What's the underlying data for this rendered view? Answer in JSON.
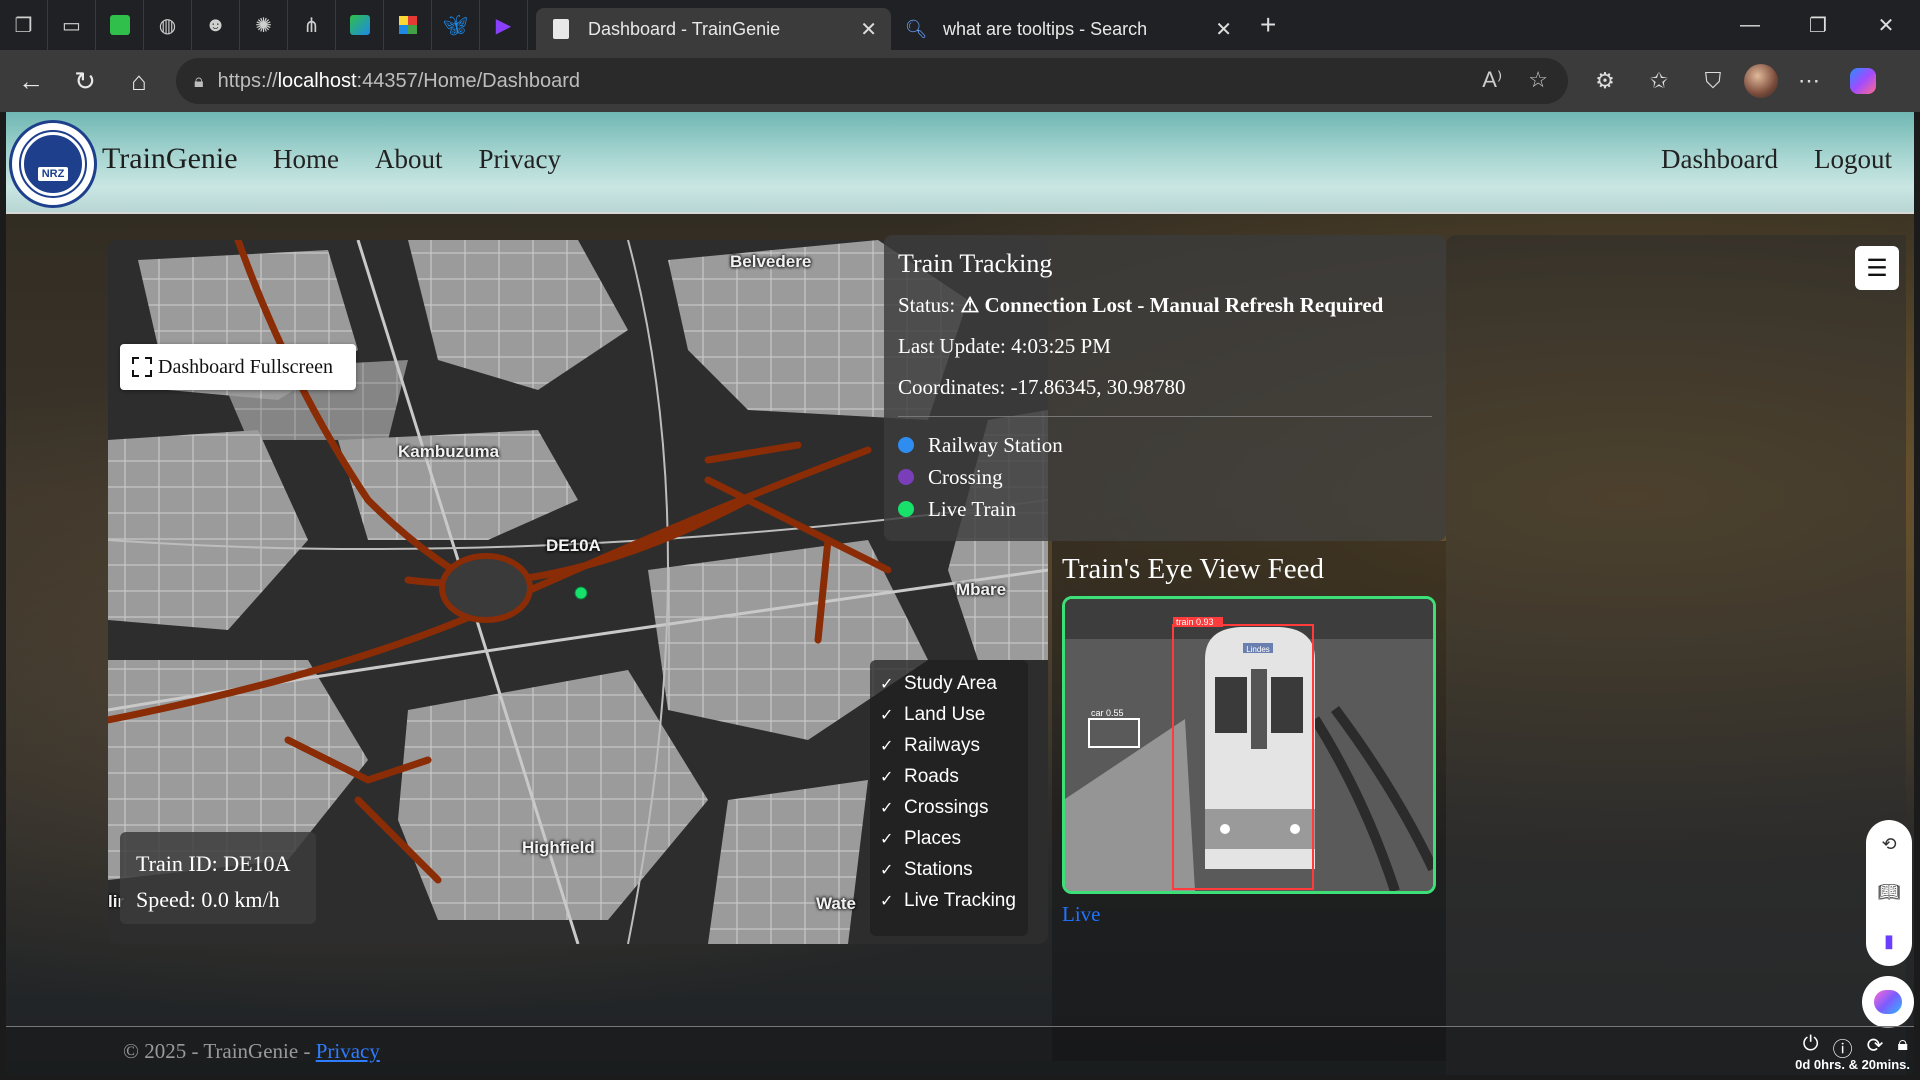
{
  "browser": {
    "tabs": [
      {
        "title": "Dashboard - TrainGenie",
        "active": true
      },
      {
        "title": "what are tooltips - Search",
        "active": false
      }
    ],
    "url_prefix": "https://",
    "url_host": "localhost",
    "url_path": ":44357/Home/Dashboard"
  },
  "navbar": {
    "brand": "TrainGenie",
    "logo_text": "NRZ",
    "links": [
      "Home",
      "About",
      "Privacy"
    ],
    "right_links": [
      "Dashboard",
      "Logout"
    ]
  },
  "map": {
    "fullscreen_label": "Dashboard Fullscreen",
    "places": [
      "Belvedere",
      "Kambuzuma",
      "DE10A",
      "Mbare",
      "Highfield",
      "Wate",
      "lir"
    ],
    "train_id_text": "Train ID: DE10A",
    "speed_text": "Speed: 0.0 km/h",
    "layers": [
      "Study Area",
      "Land Use",
      "Railways",
      "Roads",
      "Crossings",
      "Places",
      "Stations",
      "Live Tracking"
    ],
    "colors": {
      "railway": "#8a2c06",
      "live_train": "#17e06b",
      "land": "#9a9a9a",
      "background": "#2d2d2d"
    }
  },
  "tracking": {
    "title": "Train Tracking",
    "status_label": "Status:",
    "status_value": "⚠ Connection Lost - Manual Refresh Required",
    "last_update": "Last Update: 4:03:25 PM",
    "coordinates": "Coordinates: -17.86345, 30.98780",
    "legend": [
      {
        "label": "Railway Station",
        "color": "#2f8df2"
      },
      {
        "label": "Crossing",
        "color": "#7a3fb8"
      },
      {
        "label": "Live Train",
        "color": "#17e06b"
      }
    ]
  },
  "feed": {
    "title": "Train's Eye View Feed",
    "live_label": "Live",
    "detections": [
      {
        "label": "train 0.93",
        "color": "#ff3b3b"
      },
      {
        "label": "car 0.55",
        "color": "#ffffff"
      }
    ],
    "front_sign": "Lindes"
  },
  "footer": {
    "copyright": "© 2025 - TrainGenie - ",
    "privacy_link": "Privacy"
  },
  "tray": {
    "time_text": "0d 0hrs. & 20mins."
  }
}
